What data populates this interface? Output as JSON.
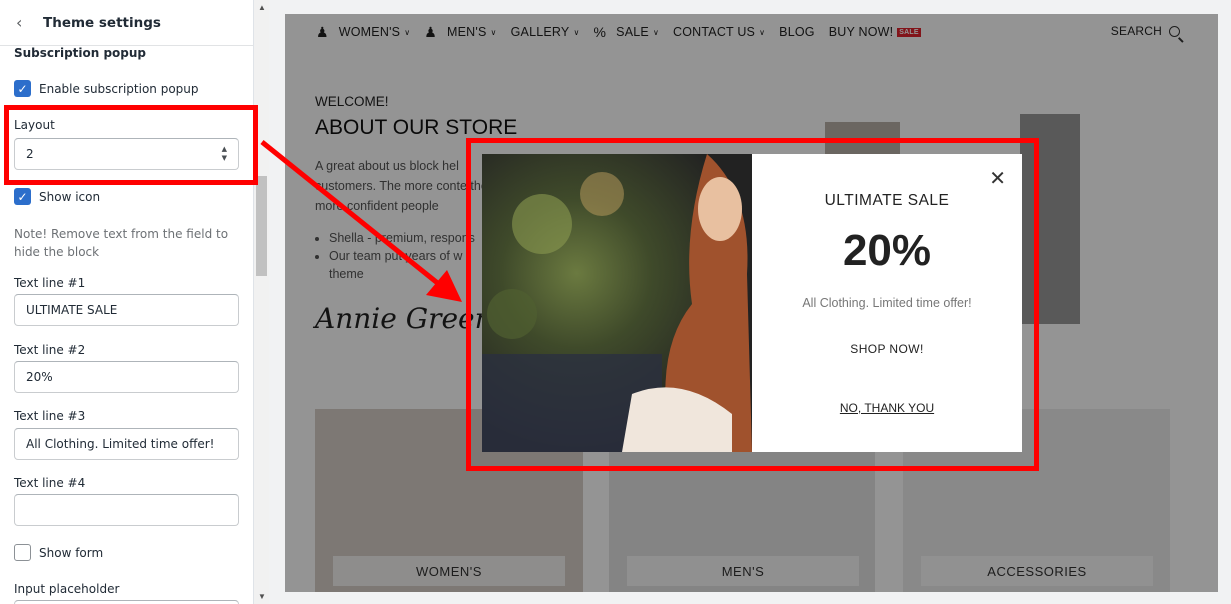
{
  "sidebar": {
    "title": "Theme settings",
    "section_title": "Subscription popup",
    "enable_popup": {
      "label": "Enable subscription popup",
      "checked": true
    },
    "layout": {
      "label": "Layout",
      "value": "2"
    },
    "show_icon": {
      "label": "Show icon",
      "checked": true
    },
    "note": "Note! Remove text from the field to hide the block",
    "text_line_1": {
      "label": "Text line #1",
      "value": "ULTIMATE SALE"
    },
    "text_line_2": {
      "label": "Text line #2",
      "value": "20%"
    },
    "text_line_3": {
      "label": "Text line #3",
      "value": "All Clothing. Limited time offer!"
    },
    "text_line_4": {
      "label": "Text line #4",
      "value": ""
    },
    "show_form": {
      "label": "Show form",
      "checked": false
    },
    "input_placeholder": {
      "label": "Input placeholder"
    }
  },
  "store": {
    "nav": [
      {
        "label": "WOMEN'S",
        "icon": "woman-icon",
        "caret": true
      },
      {
        "label": "MEN'S",
        "icon": "man-icon",
        "caret": true
      },
      {
        "label": "GALLERY",
        "icon": "",
        "caret": true
      },
      {
        "label": "SALE",
        "icon": "percent-icon",
        "caret": true
      },
      {
        "label": "CONTACT US",
        "icon": "",
        "caret": true
      },
      {
        "label": "BLOG",
        "icon": "",
        "caret": false
      },
      {
        "label": "BUY NOW!",
        "icon": "",
        "caret": false,
        "badge": "SALE"
      }
    ],
    "search_label": "SEARCH",
    "welcome": "WELCOME!",
    "about_title": "ABOUT OUR STORE",
    "about_text": "A great about us block hel customers. The more conte the more confident people",
    "bullets": [
      "Shella - premium, respons",
      "Our team put years of w theme"
    ],
    "signature": "Annie Greenberg",
    "tiles": [
      "WOMEN'S",
      "MEN'S",
      "ACCESSORIES"
    ]
  },
  "popup": {
    "line1": "ULTIMATE SALE",
    "line2": "20%",
    "line3": "All Clothing. Limited time offer!",
    "shop_now": "SHOP NOW!",
    "no_thanks": "NO, THANK YOU"
  },
  "colors": {
    "callout": "#ff0000",
    "checkbox": "#2c6ecb",
    "sale_badge": "#e0242e"
  }
}
